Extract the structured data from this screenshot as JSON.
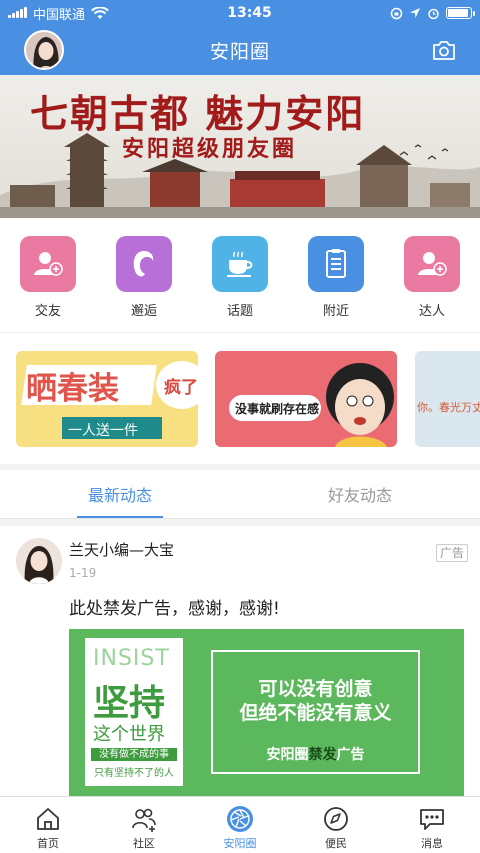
{
  "status": {
    "carrier": "中国联通",
    "time": "13:45"
  },
  "header": {
    "title": "安阳圈"
  },
  "banner": {
    "line1": "七朝古都  魅力安阳",
    "line2": "安阳超级朋友圈"
  },
  "categories": [
    {
      "label": "交友",
      "color": "#ea7aa2",
      "icon": "add-friend-icon"
    },
    {
      "label": "邂逅",
      "color": "#b86fd8",
      "icon": "encounter-icon"
    },
    {
      "label": "话题",
      "color": "#4fb3e5",
      "icon": "cup-icon"
    },
    {
      "label": "附近",
      "color": "#4a90e2",
      "icon": "list-icon"
    },
    {
      "label": "达人",
      "color": "#ea7aa2",
      "icon": "add-friend-icon"
    }
  ],
  "promos": [
    {
      "main": "晒春装",
      "side": "疯了",
      "sub": "一人送一件"
    },
    {
      "main": "没事就刷存在感"
    },
    {
      "main": "你。春光万丈"
    }
  ],
  "tabs": [
    {
      "label": "最新动态"
    },
    {
      "label": "好友动态"
    }
  ],
  "post": {
    "author": "兰天小编—大宝",
    "date": "1-19",
    "tag": "广告",
    "text": "此处禁发广告，感谢，感谢!",
    "ad": {
      "insist": "INSIST",
      "big": "坚持",
      "world": "这个世界",
      "line_a": "没有做不成的事",
      "line_b": "只有坚持不了的人",
      "slogan1": "可以没有创意",
      "slogan2": "但绝不能没有意义",
      "footer_a": "安阳圈",
      "footer_b": "禁发",
      "footer_c": "广告"
    }
  },
  "nav": [
    {
      "label": "首页",
      "icon": "home-icon"
    },
    {
      "label": "社区",
      "icon": "community-icon"
    },
    {
      "label": "安阳圈",
      "icon": "aperture-icon"
    },
    {
      "label": "便民",
      "icon": "compass-icon"
    },
    {
      "label": "消息",
      "icon": "message-icon"
    }
  ],
  "colors": {
    "primary": "#4a90e2",
    "ad_green": "#5cb85c"
  }
}
